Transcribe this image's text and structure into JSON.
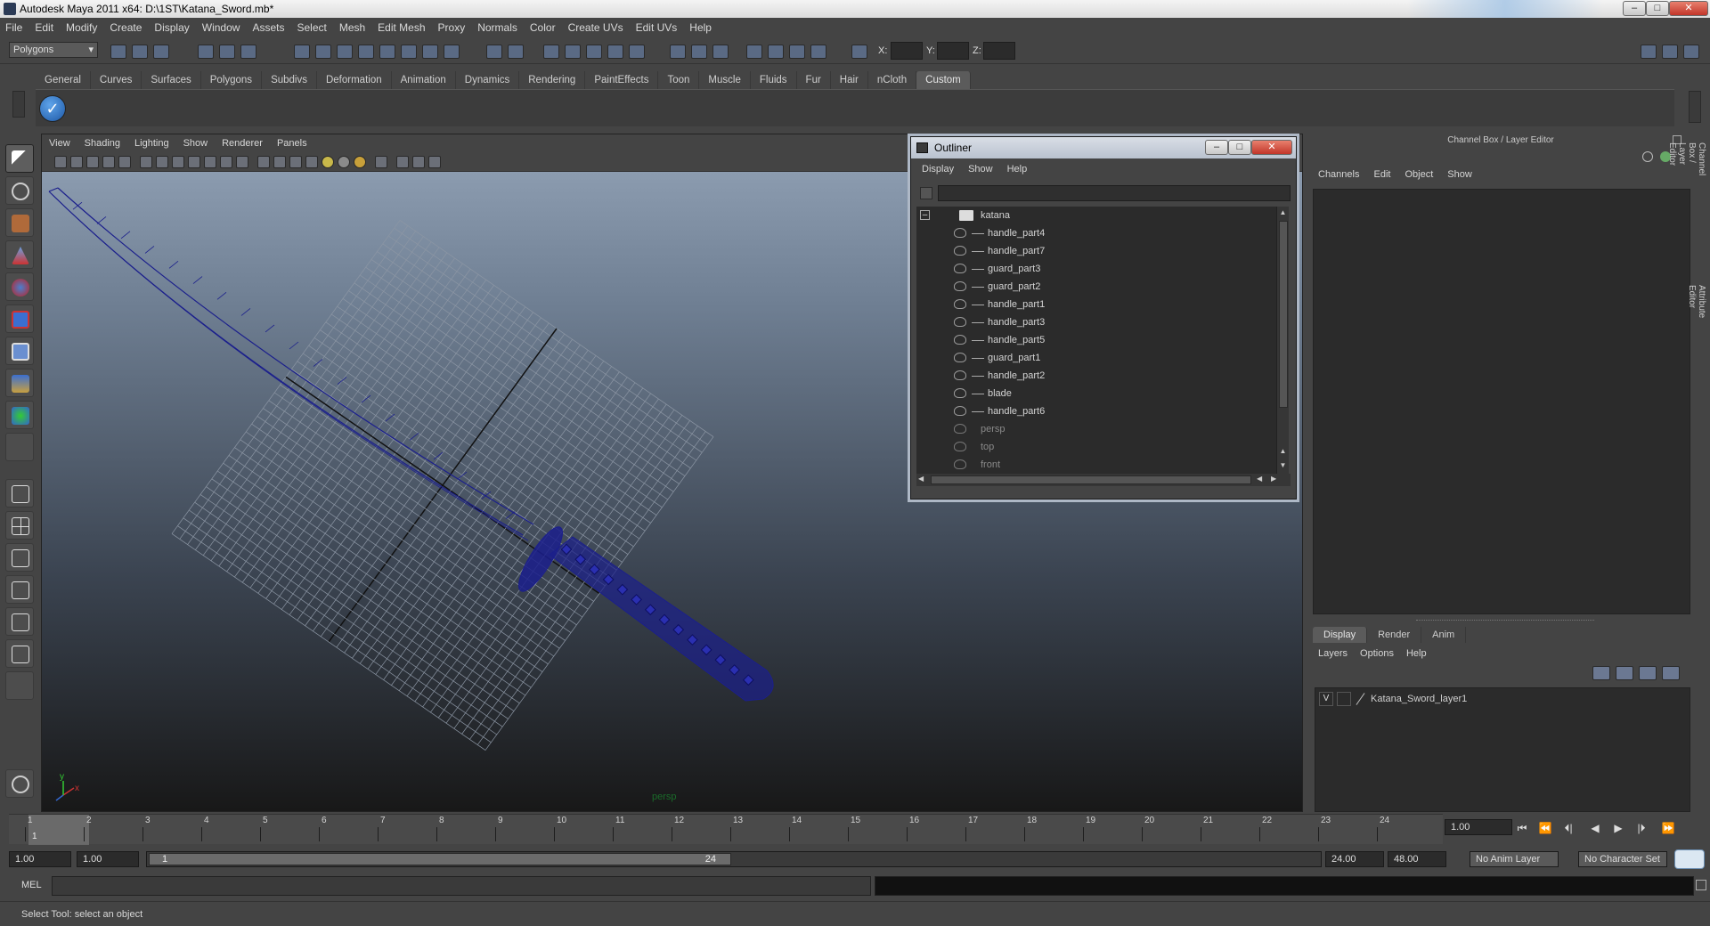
{
  "window": {
    "title": "Autodesk Maya 2011 x64: D:\\1ST\\Katana_Sword.mb*",
    "min": "–",
    "max": "□",
    "close": "✕"
  },
  "menubar": [
    "File",
    "Edit",
    "Modify",
    "Create",
    "Display",
    "Window",
    "Assets",
    "Select",
    "Mesh",
    "Edit Mesh",
    "Proxy",
    "Normals",
    "Color",
    "Create UVs",
    "Edit UVs",
    "Help"
  ],
  "statusline": {
    "mode": "Polygons",
    "x_label": "X:",
    "y_label": "Y:",
    "z_label": "Z:"
  },
  "shelf": {
    "tabs": [
      "General",
      "Curves",
      "Surfaces",
      "Polygons",
      "Subdivs",
      "Deformation",
      "Animation",
      "Dynamics",
      "Rendering",
      "PaintEffects",
      "Toon",
      "Muscle",
      "Fluids",
      "Fur",
      "Hair",
      "nCloth",
      "Custom"
    ],
    "active": "Custom",
    "button_glyph": "✓"
  },
  "viewport": {
    "menu": [
      "View",
      "Shading",
      "Lighting",
      "Show",
      "Renderer",
      "Panels"
    ],
    "camera_label": "persp",
    "axis_x": "x",
    "axis_y": "y",
    "wire_color": "#1b1f8c"
  },
  "outliner": {
    "title": "Outliner",
    "menu": [
      "Display",
      "Show",
      "Help"
    ],
    "root": "katana",
    "collapse": "–",
    "children": [
      "handle_part4",
      "handle_part7",
      "guard_part3",
      "guard_part2",
      "handle_part1",
      "handle_part3",
      "handle_part5",
      "guard_part1",
      "handle_part2",
      "blade",
      "handle_part6"
    ],
    "cameras": [
      "persp",
      "top",
      "front"
    ]
  },
  "channelbox": {
    "title": "Channel Box / Layer Editor",
    "menu": [
      "Channels",
      "Edit",
      "Object",
      "Show"
    ],
    "side_tabs": [
      "Channel Box / Layer Editor",
      "Attribute Editor"
    ]
  },
  "layers": {
    "tabs": [
      "Display",
      "Render",
      "Anim"
    ],
    "active": "Display",
    "menu": [
      "Layers",
      "Options",
      "Help"
    ],
    "rows": [
      {
        "visible": "V",
        "name": "Katana_Sword_layer1"
      }
    ]
  },
  "timeline": {
    "ticks": [
      "1",
      "2",
      "3",
      "4",
      "5",
      "6",
      "7",
      "8",
      "9",
      "10",
      "11",
      "12",
      "13",
      "14",
      "15",
      "16",
      "17",
      "18",
      "19",
      "20",
      "21",
      "22",
      "23",
      "24"
    ],
    "current_frame_marker": "1",
    "current_time": "1.00"
  },
  "playback": [
    "⏮",
    "⏪",
    "⏴|",
    "◀",
    "▶",
    "|⏵",
    "⏩"
  ],
  "range": {
    "start": "1.00",
    "playback_start": "1.00",
    "thumb_start": "1",
    "thumb_end": "24",
    "playback_end": "24.00",
    "end": "48.00",
    "anim_layer": "No Anim Layer",
    "character_set": "No Character Set"
  },
  "command": {
    "label": "MEL"
  },
  "help_line": "Select Tool: select an object"
}
